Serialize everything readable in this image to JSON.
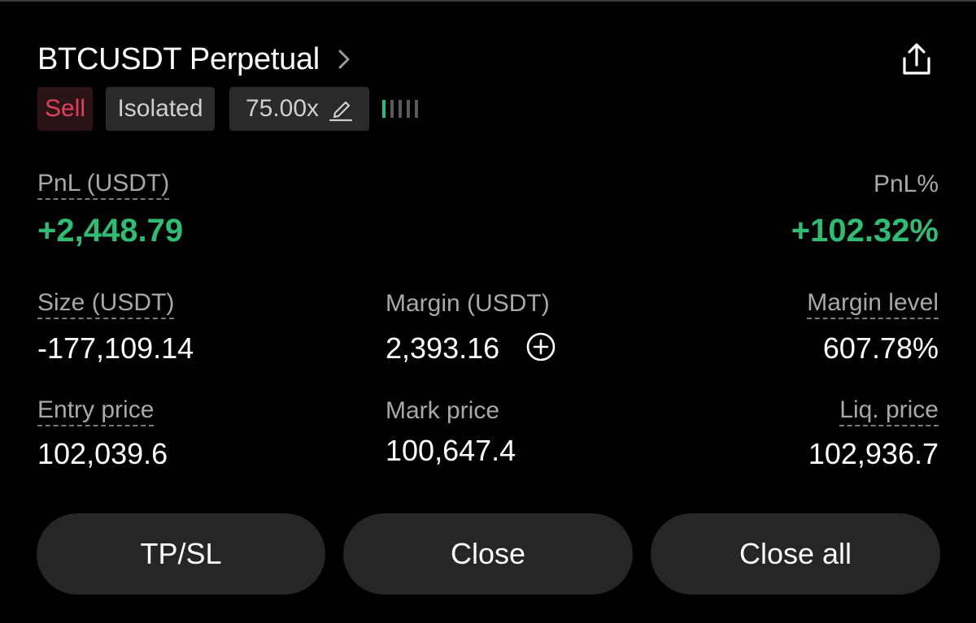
{
  "header": {
    "title": "BTCUSDT Perpetual",
    "chevron_icon": "chevron-right-icon",
    "share_icon": "share-icon"
  },
  "tags": {
    "side": "Sell",
    "margin_mode": "Isolated",
    "leverage": "75.00x",
    "edit_icon": "pencil-icon",
    "risk_bars_total": 5,
    "risk_bars_active": 1
  },
  "stats": {
    "pnl_label": "PnL (USDT)",
    "pnl_value": "+2,448.79",
    "pnl_pct_label": "PnL%",
    "pnl_pct_value": "+102.32%",
    "size_label": "Size (USDT)",
    "size_value": "-177,109.14",
    "margin_label": "Margin (USDT)",
    "margin_value": "2,393.16",
    "margin_level_label": "Margin level",
    "margin_level_value": "607.78%",
    "entry_label": "Entry price",
    "entry_value": "102,039.6",
    "mark_label": "Mark price",
    "mark_value": "100,647.4",
    "liq_label": "Liq. price",
    "liq_value": "102,936.7"
  },
  "actions": {
    "tpsl": "TP/SL",
    "close": "Close",
    "close_all": "Close all"
  },
  "colors": {
    "profit": "#2ebd73",
    "sell": "#e0405a",
    "background": "#000000",
    "button": "#262626"
  }
}
